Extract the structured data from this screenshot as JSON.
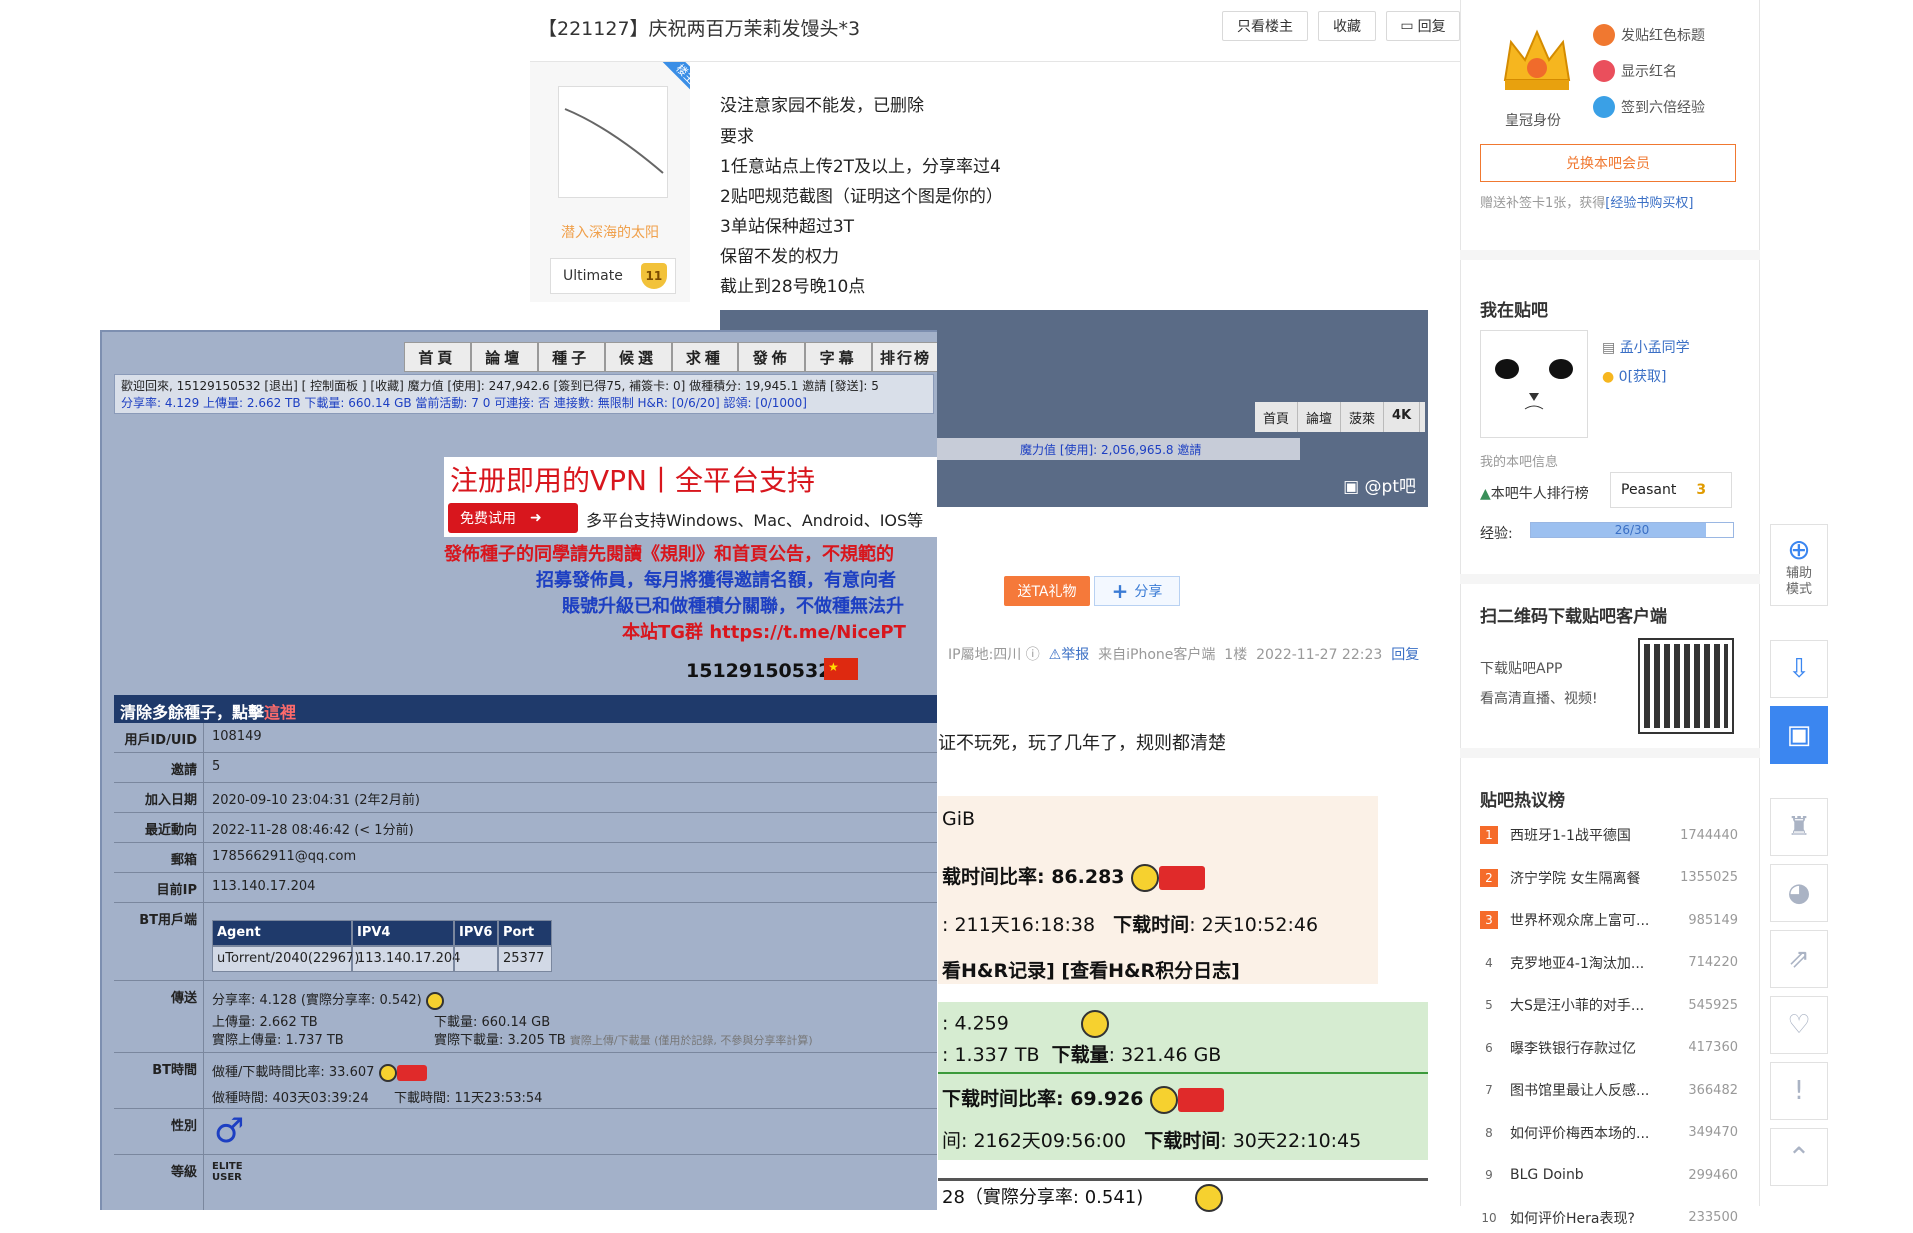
{
  "post": {
    "title": "【221127】庆祝两百万茉莉发馒头*3",
    "buttons": [
      "只看楼主",
      "收藏",
      "回复"
    ],
    "louzhu_tag": "楼主",
    "author_name": "潜入深海的太阳",
    "author_level_name": "Ultimate",
    "author_level": "11",
    "lines": [
      "没注意家园不能发，已删除",
      "要求",
      "1任意站点上传2T及以上，分享率过4",
      "2贴吧规范截图（证明这个图是你的）",
      "3单站保种超过3T",
      "保留不发的权力",
      "截止到28号晚10点"
    ],
    "bg_nav": [
      "首頁",
      "論壇",
      "菠萊",
      "4K"
    ],
    "bg_strip": "魔力值 [使用]: 2,056,965.8 邀請",
    "watermark": "@pt吧",
    "gift_label": "送TA礼物",
    "share_label": "分享",
    "meta": {
      "ip": "IP屬地:四川",
      "report": "举报",
      "source": "来自iPhone客户端",
      "floor": "1楼",
      "time": "2022-11-27 22:23",
      "reply": "回复"
    },
    "reply_text": "证不玩死，玩了几年了，规则都清楚",
    "stats": {
      "gib": "GiB",
      "ratio_time": "载时间比率: 86.283",
      "seed_time": ": 211天16:18:38",
      "dl_time_label": "下载时间",
      "dl_time": ": 2天10:52:46",
      "hr_links": "看H&R记录] [查看H&R积分日志]",
      "share_ratio": ": 4.259",
      "upload": ": 1.337 TB",
      "download_label": "下载量",
      "download": ": 321.46 GB",
      "ratio_time2": "下载时间比率: 69.926",
      "seed_time2": "间: 2162天09:56:00",
      "dl_time_label2": "下载时间",
      "dl_time2": ": 30天22:10:45",
      "bottom": "28（實際分享率: 0.541)"
    }
  },
  "overlay": {
    "nav": [
      "首頁",
      "論壇",
      "種子",
      "候選",
      "求種",
      "發佈",
      "字幕",
      "排行榜"
    ],
    "info_line1": "歡迎回來, 15129150532 [退出] [ 控制面板 ] [收藏] 魔力值 [使用]: 247,942.6 [簽到已得75, 補簽卡: 0] 做種積分: 19,945.1 邀請 [發送]: 5",
    "info_line2": "分享率: 4.129 上傳量: 2.662 TB 下載量: 660.14 GB 當前活動: 7 0 可連接: 否 連接數: 無限制 H&R: [0/6/20] 認領: [0/1000]",
    "banner_title": "注册即用的VPN丨全平台支持",
    "trial": "免费试用",
    "platforms": "多平台支持Windows、Mac、Android、IOS等",
    "notice1": "發佈種子的同學請先閱讀《規則》和首頁公告，不規範的",
    "notice2": "招募發佈員，每月將獲得邀請名額，有意向者",
    "notice3": "賬號升級已和做種積分關聯，不做種無法升",
    "notice4": "本站TG群 https://t.me/NicePT",
    "uid": "15129150532",
    "table_head": "清除多餘種子，點擊",
    "table_head_red": "這裡",
    "rows": [
      {
        "k": "用戶ID/UID",
        "v": "108149"
      },
      {
        "k": "邀請",
        "v": "5"
      },
      {
        "k": "加入日期",
        "v": "2020-09-10 23:04:31 (2年2月前)"
      },
      {
        "k": "最近動向",
        "v": "2022-11-28 08:46:42 (< 1分前)"
      },
      {
        "k": "郵箱",
        "v": "1785662911@qq.com"
      },
      {
        "k": "目前IP",
        "v": "113.140.17.204"
      }
    ],
    "bt_label": "BT用戶端",
    "bt_headers": [
      "Agent",
      "IPV4",
      "IPV6",
      "Port"
    ],
    "bt_row": [
      "uTorrent/2040(22967)",
      "113.140.17.204",
      "",
      "25377"
    ],
    "transfer_label": "傳送",
    "transfer1": "分享率: 4.128 (實際分享率: 0.542)",
    "transfer2a": "上傳量: 2.662 TB",
    "transfer2b": "下載量: 660.14 GB",
    "transfer3a": "實際上傳量: 1.737 TB",
    "transfer3b": "實際下載量: 3.205 TB",
    "transfer3c": "實際上傳/下載量 (僅用於記錄, 不參與分享率計算)",
    "bttime_label": "BT時間",
    "bttime1": "做種/下載時間比率: 33.607",
    "bttime2a": "做種時間: 403天03:39:24",
    "bttime2b": "下載時間: 11天23:53:54",
    "gender_label": "性別",
    "class_label": "等級",
    "class_name": "ELITE USER"
  },
  "sidebar": {
    "crown_label": "皇冠身份",
    "perks": [
      "发贴红色标题",
      "显示红名",
      "签到六倍经验"
    ],
    "redeem": "兑换本吧会员",
    "bonus": "赠送补签卡1张，获得",
    "bonus_link": "[经验书购买权]",
    "my_bar_title": "我在贴吧",
    "username": "孟小孟同学",
    "member": "0",
    "member_link": "[获取]",
    "my_info": "我的本吧信息",
    "rank_label": "本吧牛人排行榜",
    "rank_value": "Peasant",
    "rank_level": "3",
    "exp_label": "经验:",
    "exp_text": "26/30",
    "exp_fraction": 0.8667,
    "qr_title": "扫二维码下载贴吧客户端",
    "qr_line1": "下载贴吧APP",
    "qr_line2": "看高清直播、视频!",
    "hot_title": "贴吧热议榜",
    "hot": [
      {
        "n": "1",
        "t": "西班牙1-1战平德国",
        "c": "1744440"
      },
      {
        "n": "2",
        "t": "济宁学院 女生隔离餐",
        "c": "1355025"
      },
      {
        "n": "3",
        "t": "世界杯观众席上富可...",
        "c": "985149"
      },
      {
        "n": "4",
        "t": "克罗地亚4-1淘汰加...",
        "c": "714220"
      },
      {
        "n": "5",
        "t": "大S是汪小菲的对手...",
        "c": "545925"
      },
      {
        "n": "6",
        "t": "曝李铁银行存款过亿",
        "c": "417360"
      },
      {
        "n": "7",
        "t": "图书馆里最让人反感...",
        "c": "366482"
      },
      {
        "n": "8",
        "t": "如何评价梅西本场的...",
        "c": "349470"
      },
      {
        "n": "9",
        "t": "BLG Doinb",
        "c": "299460"
      },
      {
        "n": "10",
        "t": "如何评价Hera表现?",
        "c": "233500"
      }
    ]
  },
  "toolbar": {
    "assist": "辅助模式"
  },
  "colors": {
    "accent": "#3b86f0",
    "orange": "#f07830",
    "overlay_bg": "#a3b1c9",
    "overlay_header": "#1f3a6b"
  }
}
